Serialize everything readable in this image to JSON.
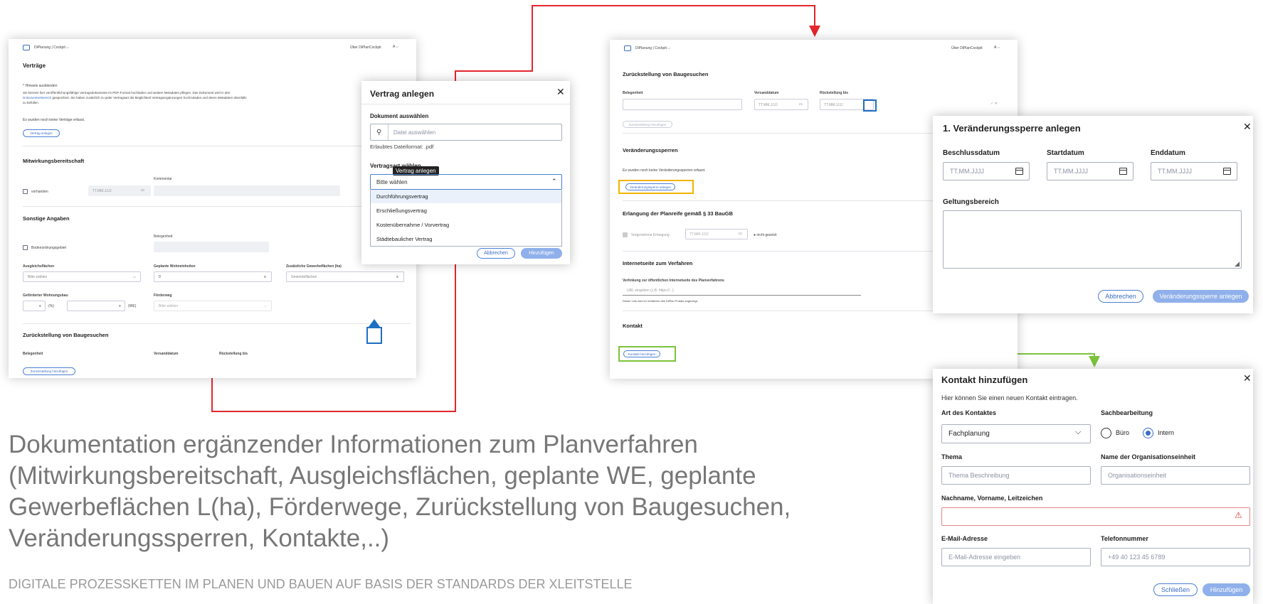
{
  "headline": "Dokumentation ergänzender Informationen zum Planverfahren (Mitwirkungsbereitschaft, Ausgleichsflächen, geplante WE, geplante Gewerbeflächen L(ha), Förderwege, Zurückstellung von Baugesuchen, Veränderungssperren, Kontakte,..)",
  "footer": "DIGITALE PROZESSKETTEN IM PLANEN UND BAUEN AUF BASIS DER STANDARDS DER XLEITSTELLE",
  "colors": {
    "red": "#e3262b",
    "blue": "#1f6fc1",
    "yellow": "#f4b400",
    "green": "#7cc43c",
    "accent": "#4a7fd4"
  },
  "app": {
    "brand": "DiPlanung",
    "module": "Cockpit",
    "about": "Über DiPlanCockpit"
  },
  "s1": {
    "title": "Verträge",
    "hint_toggle": "^ Hinweis ausblenden",
    "hint_l1": "Sie können hier veröffentlichungsfähige Vertragsdokumente im PDF-Format hochladen und weitere Metadaten pflegen. Das Dokument wird in den",
    "hint_l2a": "Dokumentenbereich",
    "hint_l2b": " gespeichert. Sie haben zusätzlich zu jeder Vertragsart die Möglichkeit Vertragsergänzungen hochzuladen und deren Metadaten ebenfalls",
    "hint_l3": "zu befüllen.",
    "empty": "Es wurden noch keine Verträge erfasst.",
    "add_contract": "Vertrag anlegen",
    "mitwirkung_title": "Mitwirkungsbereitschaft",
    "kommentar": "Kommentar",
    "vorhanden": "vorhanden",
    "date_ph": "TT.MM.JJJJ",
    "sonstige_title": "Sonstige Angaben",
    "belegenheit": "Belegenheit",
    "bodenordnung": "Bodenordnungsgebiet",
    "ausgleich": "Ausgleichsflächen",
    "ausgleich_val": "Bitte wählen",
    "wohneinheiten": "Geplante Wohneinheiten",
    "wohneinheiten_val": "0",
    "gewerbe": "Zusätzliche Gewerbeflächen (ha)",
    "gewerbe_ph": "Gewerbeflächen",
    "wohnungsbau": "Geförderter Wohnungsbau",
    "pct": "(%)",
    "we": "(WE)",
    "foerderweg": "Förderweg",
    "foerderweg_val": "Bitte wählen",
    "zurueck_title": "Zurückstellung von Baugesuchen",
    "col_belegenheit": "Belegenheit",
    "col_versand": "Versanddatum",
    "col_rueck": "Rückstellung bis",
    "add_zurueck": "Zurückstellung hinzufügen"
  },
  "m1": {
    "title": "Vertrag anlegen",
    "doc_label": "Dokument auswählen",
    "file_ph": "Datei auswählen",
    "format": "Erlaubtes Dateiformat: .pdf",
    "type_label": "Vertragsart wählen",
    "tooltip": "Vertrag anlegen",
    "select_val": "Bitte wählen",
    "options": [
      "Durchführungsvertrag",
      "Erschließungsvertrag",
      "Kostenübernahme / Vorvertrag",
      "Städtebaulicher Vertrag"
    ],
    "cancel": "Abbrechen",
    "add": "Hinzufügen"
  },
  "s2": {
    "title": "Zurückstellung von Baugesuchen",
    "col_belegenheit": "Belegenheit",
    "col_versand": "Versanddatum",
    "col_rueck": "Rückstellung bis",
    "date_ph": "TT.MM.JJJJ",
    "add_zurueck": "Zurückstellung hinzufügen",
    "vs_title": "Veränderungssperren",
    "vs_empty": "Es wurden noch keine Veränderungssperren erfasst.",
    "vs_add": "Veränderungssperre anlegen",
    "pr_title": "Erlangung der Planreife gemäß § 33 BauGB",
    "pr_cb": "Vorgesehene Erlangung",
    "pr_status": "nicht gesetzt",
    "web_title": "Internetseite zum Verfahren",
    "web_label": "Verlinkung zur öffentlichen Internetseite des Planverfahrens",
    "web_ph": "URL eingeben (z.B. https://...)",
    "web_hint": "Dieser Link wird im Verfahren des DiPlan Portals angezeigt.",
    "kontakt_title": "Kontakt",
    "kontakt_add": "Kontakt hinzufügen"
  },
  "m2": {
    "title": "1. Veränderungssperre anlegen",
    "beschluss": "Beschlussdatum",
    "start": "Startdatum",
    "end": "Enddatum",
    "date_ph": "TT.MM.JJJJ",
    "geltung": "Geltungsbereich",
    "cancel": "Abbrechen",
    "submit": "Veränderungssperre anlegen"
  },
  "m3": {
    "title": "Kontakt hinzufügen",
    "subtitle": "Hier können Sie einen neuen Kontakt eintragen.",
    "art_label": "Art des Kontaktes",
    "art_val": "Fachplanung",
    "sach_label": "Sachbearbeitung",
    "opt_buero": "Büro",
    "opt_intern": "Intern",
    "thema_label": "Thema",
    "thema_ph": "Thema Beschreibung",
    "org_label": "Name der Organisationseinheit",
    "org_ph": "Organisationseinheit",
    "name_label": "Nachname, Vorname, Leitzeichen",
    "email_label": "E-Mail-Adresse",
    "email_ph": "E-Mail-Adresse eingeben",
    "tel_label": "Telefonnummer",
    "tel_ph": "+49 40 123 45 6789",
    "close": "Schließen",
    "add": "Hinzufügen"
  }
}
